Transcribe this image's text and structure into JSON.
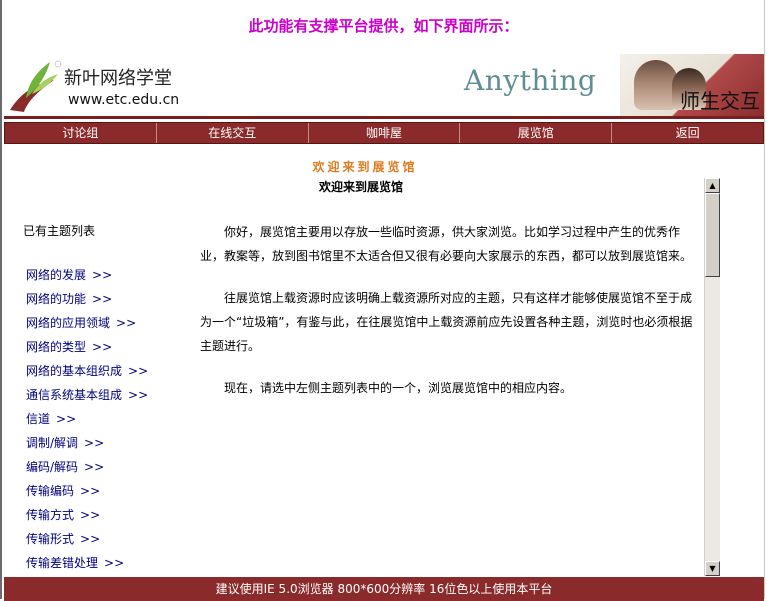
{
  "intro": "此功能有支撑平台提供，如下界面所示：",
  "header": {
    "logo_title": "新叶网络学堂",
    "logo_url": "www.etc.edu.cn",
    "anything": "Anything",
    "teacher_label": "师生交互"
  },
  "nav": [
    {
      "label": "讨论组"
    },
    {
      "label": "在线交互"
    },
    {
      "label": "咖啡屋"
    },
    {
      "label": "展览馆"
    },
    {
      "label": "返回"
    }
  ],
  "welcome_orange": "欢迎来到展览馆",
  "welcome_black": "欢迎来到展览馆",
  "topics_title": "已有主题列表",
  "topics": [
    {
      "label": "网络的发展"
    },
    {
      "label": "网络的功能"
    },
    {
      "label": "网络的应用领域"
    },
    {
      "label": "网络的类型"
    },
    {
      "label": "网络的基本组织成"
    },
    {
      "label": "通信系统基本组成"
    },
    {
      "label": "信道"
    },
    {
      "label": "调制/解调"
    },
    {
      "label": "编码/解码"
    },
    {
      "label": "传输编码"
    },
    {
      "label": "传输方式"
    },
    {
      "label": "传输形式"
    },
    {
      "label": "传输差错处理"
    }
  ],
  "topic_arrow": ">>",
  "content": {
    "p1": "你好，展览馆主要用以存放一些临时资源，供大家浏览。比如学习过程中产生的优秀作业，教案等，放到图书馆里不太适合但又很有必要向大家展示的东西，都可以放到展览馆来。",
    "p2": "往展览馆上载资源时应该明确上载资源所对应的主题，只有这样才能够使展览馆不至于成为一个“垃圾箱”，有鉴与此，在往展览馆中上载资源前应先设置各种主题，浏览时也必须根据主题进行。",
    "p3": "现在，请选中左侧主题列表中的一个，浏览展览馆中的相应内容。"
  },
  "footer": "建议使用IE 5.0浏览器 800*600分辨率 16位色以上使用本平台",
  "colors": {
    "intro": "#cc00cc",
    "nav_bg": "#8b2a2a",
    "welcome_orange": "#e07a1e",
    "link": "#000080"
  }
}
